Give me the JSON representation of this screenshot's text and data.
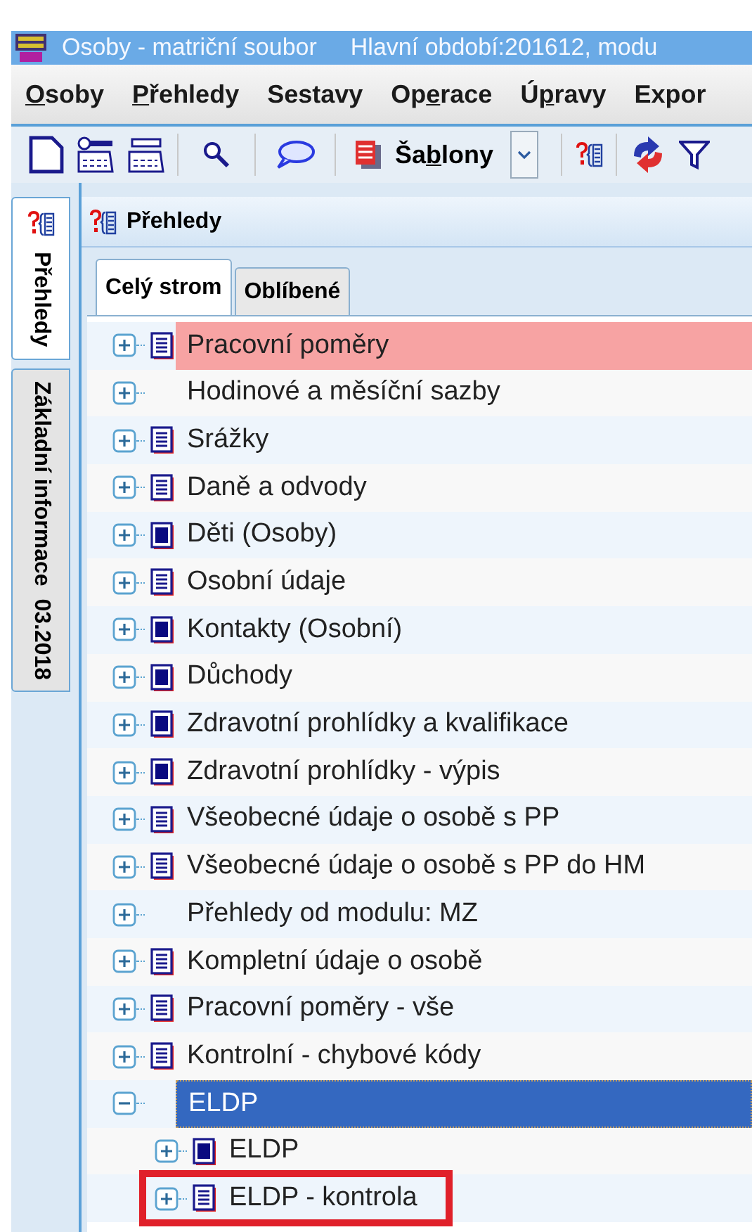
{
  "window": {
    "title": "Osoby - matriční soubor",
    "subtitle": "Hlavní období:201612, modu"
  },
  "menu": [
    {
      "key": "O",
      "after": "soby"
    },
    {
      "key": "P",
      "after": "řehledy"
    },
    {
      "before": "Sestavy"
    },
    {
      "before": "Op",
      "key": "e",
      "after": "race"
    },
    {
      "before": "Ú",
      "key": "p",
      "after": "ravy"
    },
    {
      "before": "Expor"
    }
  ],
  "toolbar": {
    "templates_button": {
      "before": "Ša",
      "key": "b",
      "after": "lony"
    }
  },
  "side_tabs": [
    {
      "label": "Přehledy",
      "selected": true,
      "kind": "icon"
    },
    {
      "label": "Základní informace  03.2018",
      "selected": false,
      "kind": "plain"
    }
  ],
  "panel": {
    "title": "Přehledy",
    "tabs": [
      {
        "label": "Celý strom",
        "selected": true
      },
      {
        "label": "Oblíbené",
        "selected": false
      }
    ],
    "tree": [
      {
        "label": "Pracovní poměry",
        "kind": "list",
        "expanded": false,
        "selected": false,
        "flagged": true
      },
      {
        "label": "Hodinové a měsíční sazby",
        "kind": "none",
        "expanded": false,
        "selected": false,
        "flagged": false
      },
      {
        "label": "Srážky",
        "kind": "list",
        "expanded": false,
        "selected": false,
        "flagged": false
      },
      {
        "label": "Daně a odvody",
        "kind": "list",
        "expanded": false,
        "selected": false,
        "flagged": false
      },
      {
        "label": "Děti (Osoby)",
        "kind": "square",
        "expanded": false,
        "selected": false,
        "flagged": false
      },
      {
        "label": "Osobní údaje",
        "kind": "list",
        "expanded": false,
        "selected": false,
        "flagged": false
      },
      {
        "label": "Kontakty (Osobní)",
        "kind": "square",
        "expanded": false,
        "selected": false,
        "flagged": false
      },
      {
        "label": "Důchody",
        "kind": "square",
        "expanded": false,
        "selected": false,
        "flagged": false
      },
      {
        "label": "Zdravotní prohlídky a kvalifikace",
        "kind": "square",
        "expanded": false,
        "selected": false,
        "flagged": false
      },
      {
        "label": "Zdravotní prohlídky - výpis",
        "kind": "square",
        "expanded": false,
        "selected": false,
        "flagged": false
      },
      {
        "label": "Všeobecné údaje o osobě s PP",
        "kind": "list",
        "expanded": false,
        "selected": false,
        "flagged": false
      },
      {
        "label": "Všeobecné údaje o osobě s PP do HM",
        "kind": "list",
        "expanded": false,
        "selected": false,
        "flagged": false
      },
      {
        "label": "Přehledy od modulu: MZ",
        "kind": "none",
        "expanded": false,
        "selected": false,
        "flagged": false
      },
      {
        "label": "Kompletní údaje o osobě",
        "kind": "list",
        "expanded": false,
        "selected": false,
        "flagged": false
      },
      {
        "label": "Pracovní poměry - vše",
        "kind": "list",
        "expanded": false,
        "selected": false,
        "flagged": false
      },
      {
        "label": "Kontrolní - chybové kódy",
        "kind": "list",
        "expanded": false,
        "selected": false,
        "flagged": false
      },
      {
        "label": "ELDP",
        "kind": "none",
        "expanded": true,
        "selected": true,
        "flagged": false,
        "children": [
          {
            "label": "ELDP",
            "kind": "square",
            "expanded": false,
            "selected": false,
            "flagged": false
          },
          {
            "label": "ELDP - kontrola",
            "kind": "list",
            "expanded": false,
            "selected": false,
            "flagged": false,
            "annotated": true
          }
        ]
      }
    ]
  }
}
